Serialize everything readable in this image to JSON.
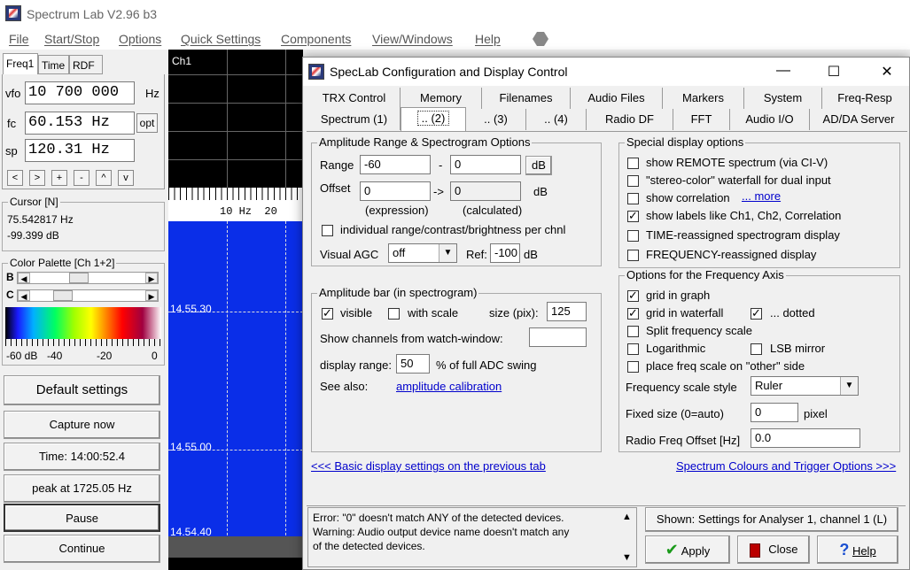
{
  "main_window": {
    "title": "Spectrum Lab V2.96 b3"
  },
  "menu": [
    "File",
    "Start/Stop",
    "Options",
    "Quick Settings",
    "Components",
    "View/Windows",
    "Help"
  ],
  "left": {
    "tabs": [
      "Freq1",
      "Time",
      "RDF"
    ],
    "vfo_label": "vfo",
    "vfo_value": "10 700 000",
    "vfo_unit": "Hz",
    "fc_label": "fc",
    "fc_value": "60.153 Hz",
    "opt_label": "opt",
    "sp_label": "sp",
    "sp_value": "120.31 Hz",
    "step_buttons": [
      "<",
      ">",
      "+",
      "-",
      "^",
      "v"
    ],
    "cursor_title": "Cursor [N]",
    "cursor_freq": "75.542817 Hz",
    "cursor_db": "-99.399 dB",
    "palette_title": "Color Palette [Ch 1+2]",
    "palette_b": "B",
    "palette_c": "C",
    "palette_scale": [
      "-60 dB",
      "-40",
      "-20",
      "0"
    ],
    "default_settings": "Default settings",
    "capture_now": "Capture now",
    "time_label": "Time:  14:00:52.4",
    "peak_label": "peak at 1725.05 Hz",
    "pause": "Pause",
    "continue": "Continue"
  },
  "spectrum": {
    "channel": "Ch1",
    "scale_label": "10 Hz  20",
    "times": [
      "14.55.30",
      "14.55.00",
      "14.54.40"
    ]
  },
  "dialog": {
    "title": "SpecLab  Configuration and Display Control",
    "tabs_row1": [
      "TRX Control",
      "Memory",
      "Filenames",
      "Audio Files",
      "Markers",
      "System",
      "Freq-Resp"
    ],
    "tabs_row2": [
      "Spectrum (1)",
      ".. (2)",
      ".. (3)",
      ".. (4)",
      "Radio DF",
      "FFT",
      "Audio I/O",
      "AD/DA Server"
    ],
    "amp": {
      "title": "Amplitude Range & Spectrogram Options",
      "range_label": "Range",
      "range_min": "-60",
      "dash": "-",
      "range_max": "0",
      "db_btn": "dB",
      "offset_label": "Offset",
      "offset_expr": "0",
      "arrow": "->",
      "offset_calc": "0",
      "db": "dB",
      "expression": "(expression)",
      "calculated": "(calculated)",
      "individual": "individual range/contrast/brightness per chnl",
      "visual_agc_label": "Visual AGC",
      "visual_agc_value": "off",
      "ref_label": "Ref:",
      "ref_value": "-100",
      "ref_unit": "dB"
    },
    "ampbar": {
      "title": "Amplitude bar (in spectrogram)",
      "visible": "visible",
      "with_scale": "with scale",
      "size_label": "size (pix):",
      "size_value": "125",
      "show_channels": "Show channels from watch-window:",
      "show_channels_value": "",
      "display_range_label": "display range:",
      "display_range_value": "50",
      "display_range_suffix": "% of full ADC swing",
      "see_also": "See also:",
      "amp_cal_link": "amplitude calibration"
    },
    "special": {
      "title": "Special display options",
      "items": [
        {
          "label": "show REMOTE spectrum (via CI-V)",
          "checked": false
        },
        {
          "label": "\"stereo-color\" waterfall for dual input",
          "checked": false
        },
        {
          "label": "show correlation",
          "checked": false
        },
        {
          "label": "show labels like Ch1, Ch2, Correlation",
          "checked": true
        },
        {
          "label": "TIME-reassigned spectrogram display",
          "checked": false
        },
        {
          "label": "FREQUENCY-reassigned display",
          "checked": false
        }
      ],
      "more_link": "... more"
    },
    "freqaxis": {
      "title": "Options for the Frequency Axis",
      "grid_in_graph": "grid in graph",
      "grid_in_waterfall": "grid in waterfall",
      "dotted": "... dotted",
      "split": "Split frequency scale",
      "log": "Logarithmic",
      "lsb": "LSB mirror",
      "other_side": "place freq scale on \"other\" side",
      "style_label": "Frequency scale style",
      "style_value": "Ruler",
      "fixed_label": "Fixed size (0=auto)",
      "fixed_value": "0",
      "fixed_unit": "pixel",
      "rf_offset_label": "Radio Freq Offset [Hz]",
      "rf_offset_value": "0.0"
    },
    "nav": {
      "prev_link": "<<< Basic display settings on the previous tab",
      "next_link": "Spectrum Colours and Trigger Options >>>"
    },
    "status": {
      "line1": "Error: \"0\" doesn't match ANY of the detected devices.",
      "line2": "Warning: Audio output device name doesn't match any",
      "line3": "of the detected devices."
    },
    "shown": "Shown: Settings for Analyser 1, channel 1 (L)",
    "apply": "Apply",
    "close": "Close",
    "help": "Help"
  }
}
